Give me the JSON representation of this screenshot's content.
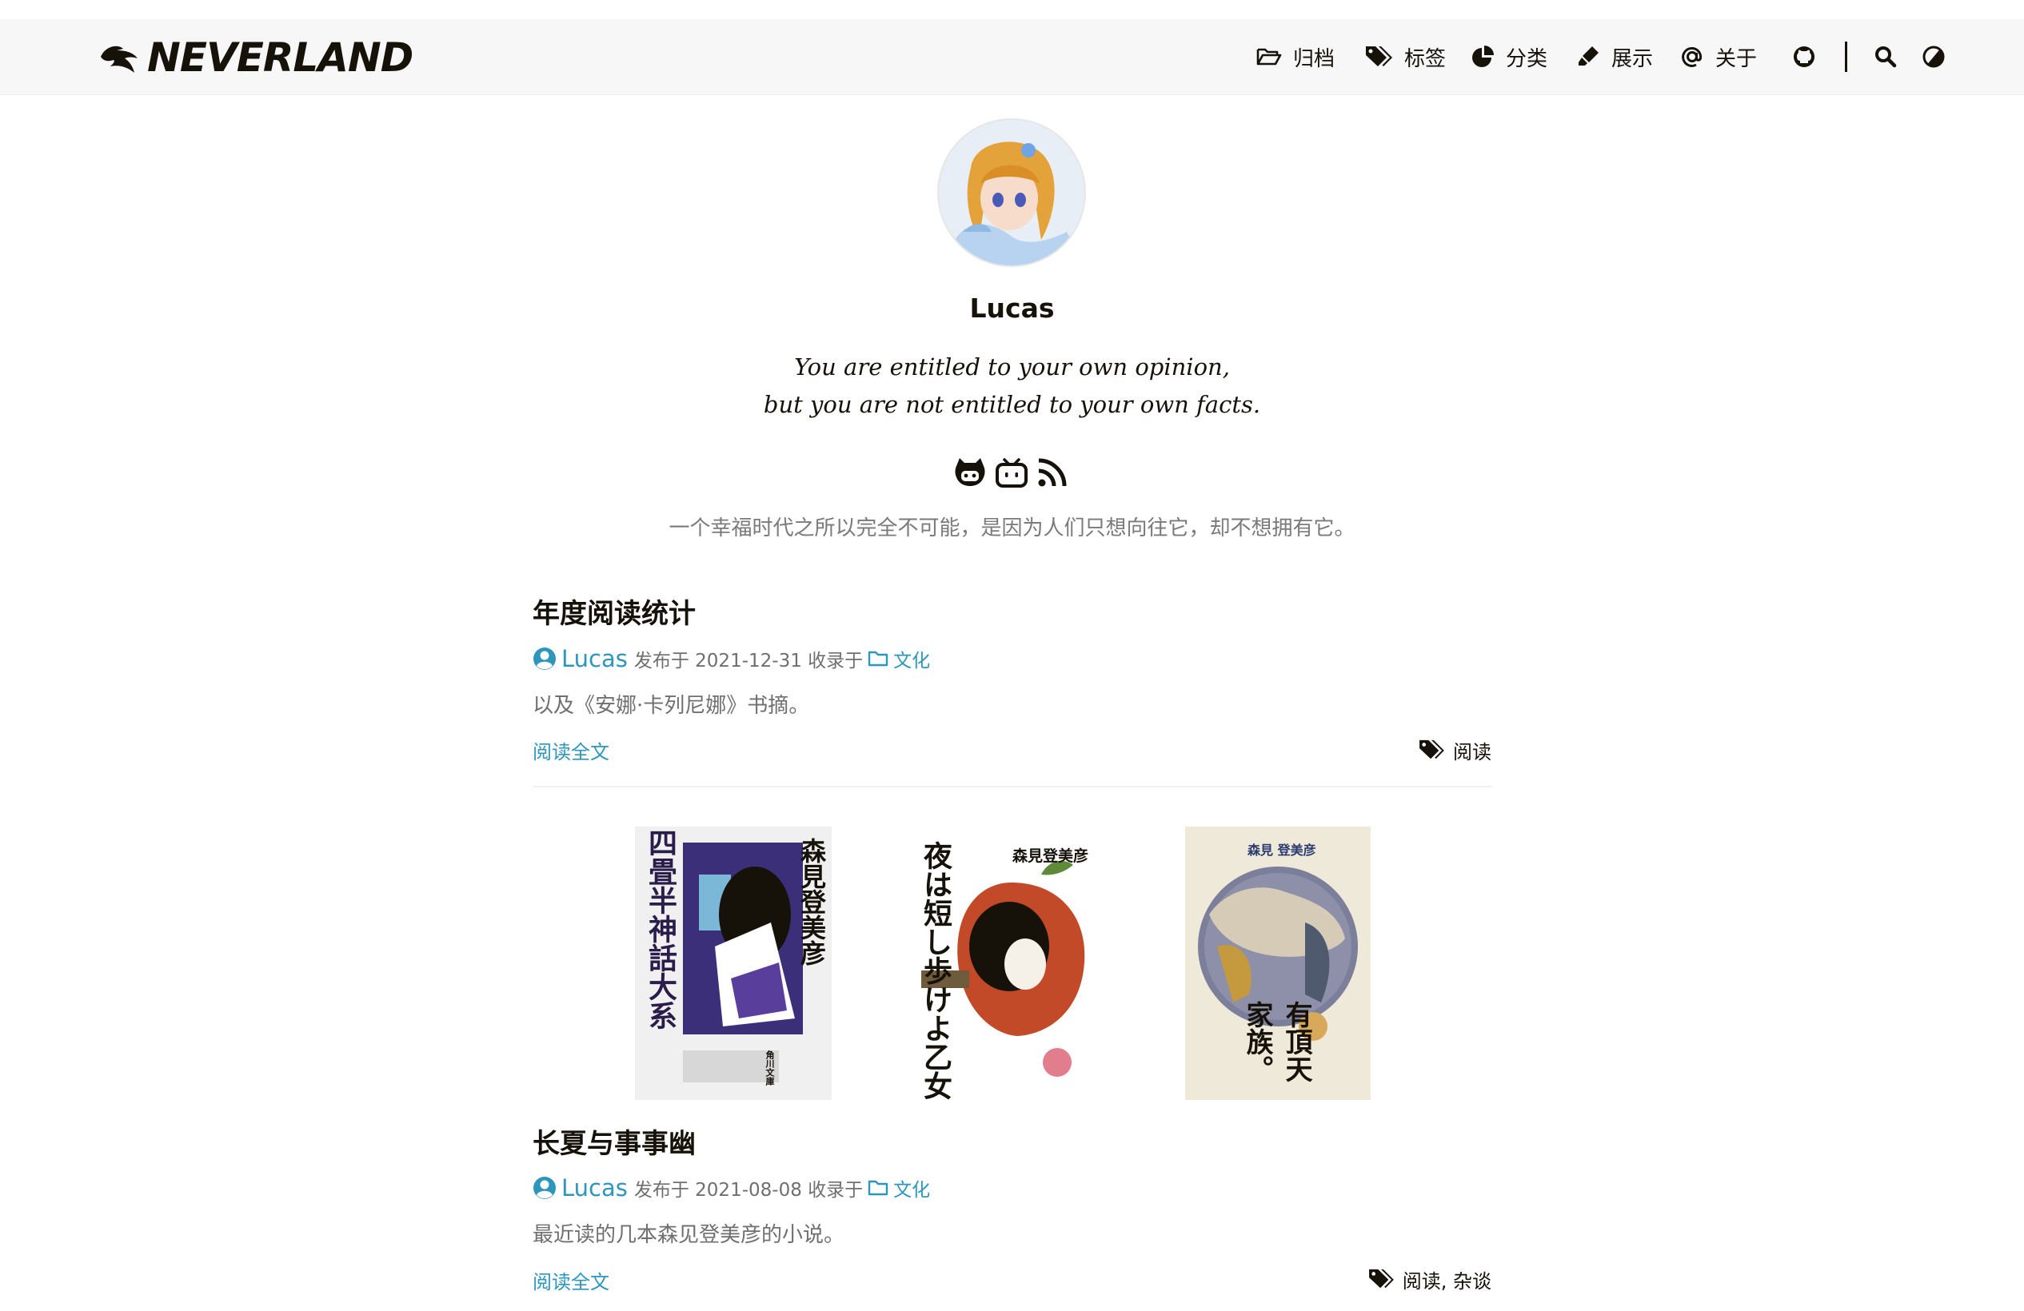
{
  "header": {
    "logo_text": "NEVERLAND",
    "nav": [
      {
        "label": "归档",
        "icon": "folder-open-icon"
      },
      {
        "label": "标签",
        "icon": "tags-icon"
      },
      {
        "label": "分类",
        "icon": "pie-chart-icon"
      },
      {
        "label": "展示",
        "icon": "highlighter-icon"
      },
      {
        "label": "关于",
        "icon": "at-icon"
      }
    ],
    "icons": [
      "github-icon",
      "search-icon",
      "theme-toggle-icon"
    ]
  },
  "profile": {
    "name": "Lucas",
    "quote_line1": "You are entitled to your own opinion,",
    "quote_line2": "but you are not entitled to your own facts.",
    "social": [
      "github-icon",
      "bilibili-icon",
      "rss-icon"
    ],
    "motto": "一个幸福时代之所以完全不可能，是因为人们只想向往它，却不想拥有它。"
  },
  "posts": [
    {
      "title": "年度阅读统计",
      "author": "Lucas",
      "published_prefix": "发布于 2021-12-31 收录于",
      "category": "文化",
      "summary": "以及《安娜·卡列尼娜》书摘。",
      "read_more": "阅读全文",
      "tags": "阅读"
    },
    {
      "title": "长夏与事事幽",
      "author": "Lucas",
      "published_prefix": "发布于 2021-08-08 收录于",
      "category": "文化",
      "summary": "最近读的几本森见登美彦的小说。",
      "read_more": "阅读全文",
      "tags": "阅读, 杂谈",
      "covers": [
        {
          "title": "四畳半神話大系",
          "author": "森見登美彦",
          "publisher": "角川文庫"
        },
        {
          "title": "夜は短し歩けよ乙女",
          "author": "森見登美彦"
        },
        {
          "title": "有頂天家族。",
          "author": "森見 登美彦"
        }
      ]
    }
  ]
}
